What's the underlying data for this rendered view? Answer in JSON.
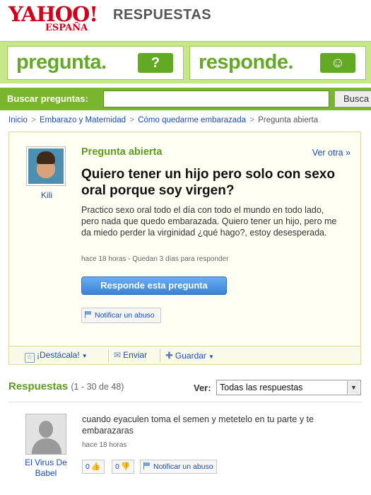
{
  "header": {
    "logo_yahoo": "YAHOO!",
    "logo_region": "ESPAÑA",
    "section": "RESPUESTAS"
  },
  "banner": {
    "ask_word": "pregunta.",
    "ask_badge": "?",
    "answer_word": "responde.",
    "answer_badge": "☺"
  },
  "search": {
    "label": "Buscar preguntas:",
    "value": "",
    "button": "Busca"
  },
  "breadcrumb": {
    "items": [
      "Inicio",
      "Embarazo y Maternidad",
      "Cómo quedarme embarazada"
    ],
    "current": "Pregunta abierta",
    "separator": ">"
  },
  "question": {
    "user": "Kili",
    "status": "Pregunta abierta",
    "see_other": "Ver otra »",
    "title": "Quiero tener un hijo pero solo con sexo oral porque soy virgen?",
    "body": "Practico sexo oral todo el día con todo el mundo en todo lado, pero nada que quedo embarazada. Quiero tener un hijo, pero me da miedo perder la virginidad ¿qué hago?, estoy desesperada.",
    "meta": "hace 18 horas - Quedan 3 días para responder",
    "answer_button": "Responde esta pregunta",
    "report": "Notificar un abuso"
  },
  "toolbar": {
    "star": "¡Destácala!",
    "send": "Enviar",
    "save": "Guardar"
  },
  "answers": {
    "title": "Respuestas",
    "count": "(1 - 30 de 48)",
    "view_label": "Ver:",
    "view_selected": "Todas las respuestas",
    "items": [
      {
        "user": "El Virus De Babel",
        "text": "cuando eyaculen toma el semen y metetelo en tu parte y te embarazaras",
        "meta": "hace 18 horas",
        "thumbs_up": "0",
        "thumbs_down": "0",
        "report": "Notificar un abuso"
      }
    ]
  },
  "colors": {
    "brand_red": "#d0021b",
    "green": "#63a924",
    "link_blue": "#1a4db5"
  }
}
